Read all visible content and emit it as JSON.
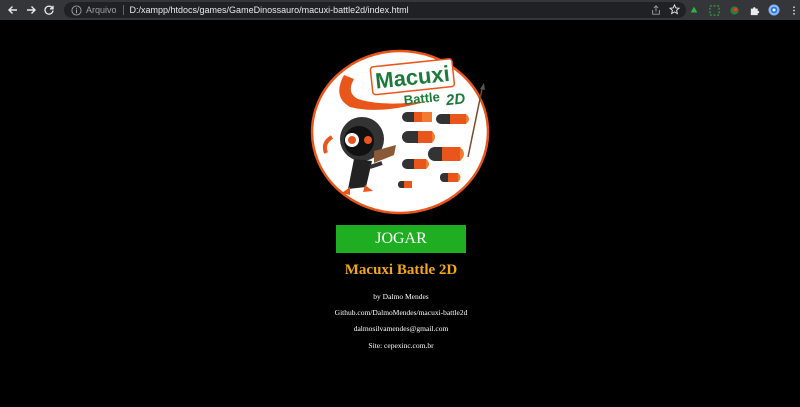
{
  "browser": {
    "scheme_label": "Arquivo",
    "url": "D:/xampp/htdocs/games/GameDinossauro/macuxi-battle2d/index.html"
  },
  "logo": {
    "title_word": "Macuxi",
    "subtitle": "Battle",
    "subtitle_suffix": "2D"
  },
  "play_button": {
    "label": "JOGAR"
  },
  "game": {
    "title": "Macuxi Battle 2D",
    "author": "by Dalmo Mendes",
    "github": "Github.com/DalmoMendes/macuxi-battle2d",
    "email": "dalmosilvamendes@gmail.com",
    "site": "Site: cepexinc.com.br"
  },
  "colors": {
    "accent_title": "#f2a71b",
    "play_button": "#1fad22",
    "logo_green": "#1e7a3a",
    "logo_orange": "#e8561c"
  }
}
